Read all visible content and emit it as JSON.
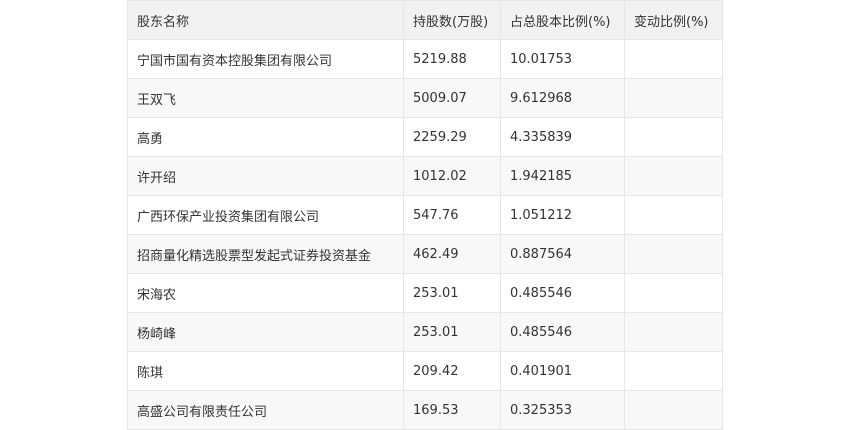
{
  "table": {
    "headers": [
      "股东名称",
      "持股数(万股)",
      "占总股本比例(%)",
      "变动比例(%)"
    ],
    "rows": [
      [
        "宁国市国有资本控股集团有限公司",
        "5219.88",
        "10.01753",
        ""
      ],
      [
        "王双飞",
        "5009.07",
        "9.612968",
        ""
      ],
      [
        "高勇",
        "2259.29",
        "4.335839",
        ""
      ],
      [
        "许开绍",
        "1012.02",
        "1.942185",
        ""
      ],
      [
        "广西环保产业投资集团有限公司",
        "547.76",
        "1.051212",
        ""
      ],
      [
        "招商量化精选股票型发起式证券投资基金",
        "462.49",
        "0.887564",
        ""
      ],
      [
        "宋海农",
        "253.01",
        "0.485546",
        ""
      ],
      [
        "杨崎峰",
        "253.01",
        "0.485546",
        ""
      ],
      [
        "陈琪",
        "209.42",
        "0.401901",
        ""
      ],
      [
        "高盛公司有限责任公司",
        "169.53",
        "0.325353",
        ""
      ]
    ]
  }
}
